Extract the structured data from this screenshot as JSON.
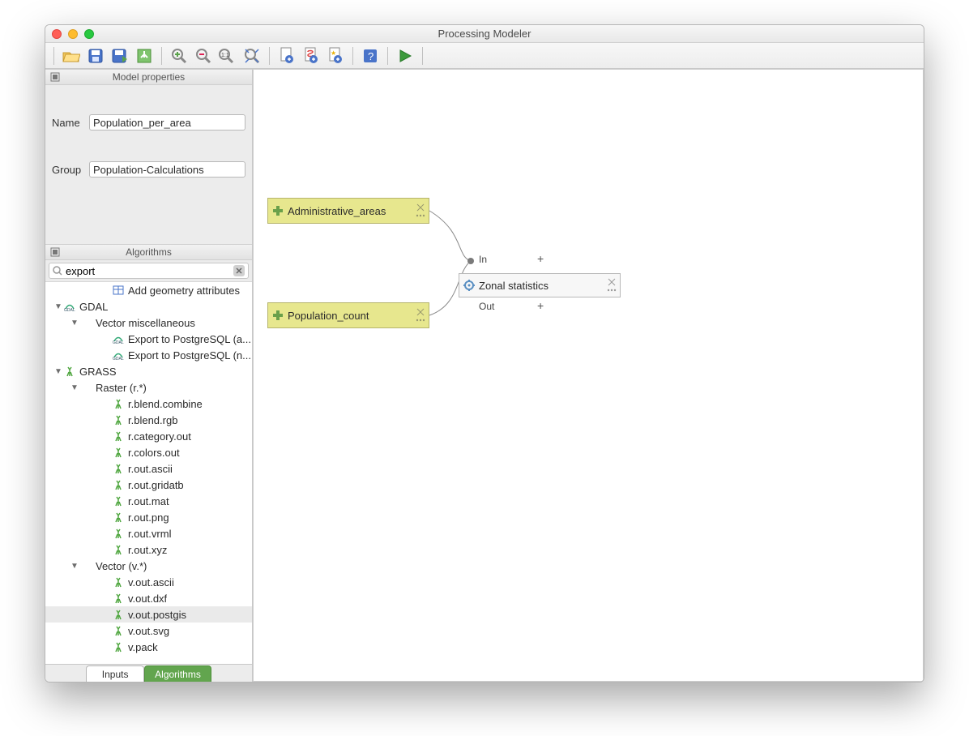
{
  "window": {
    "title": "Processing Modeler"
  },
  "toolbar": {
    "open": "open-folder-icon",
    "save": "save-icon",
    "saveas": "save-as-icon",
    "open_model": "open-model-icon",
    "zoom_in": "zoom-in-icon",
    "zoom_out": "zoom-out-icon",
    "zoom_11": "zoom-1-1-icon",
    "zoom_full": "zoom-full-icon",
    "export_img": "export-image-icon",
    "export_pdf": "export-pdf-icon",
    "export_py": "export-python-icon",
    "help": "help-icon",
    "run": "run-icon"
  },
  "panels": {
    "model_properties": "Model properties",
    "algorithms": "Algorithms"
  },
  "props": {
    "name_label": "Name",
    "name_value": "Population_per_area",
    "group_label": "Group",
    "group_value": "Population-Calculations"
  },
  "search": {
    "value": "export",
    "placeholder": ""
  },
  "tree": [
    {
      "d": 3,
      "disc": "",
      "ico": "table",
      "label": "Add geometry attributes"
    },
    {
      "d": 0,
      "disc": "▼",
      "ico": "gdal",
      "label": "GDAL"
    },
    {
      "d": 1,
      "disc": "▼",
      "ico": "",
      "label": "Vector miscellaneous"
    },
    {
      "d": 3,
      "disc": "",
      "ico": "gdal",
      "label": "Export to PostgreSQL (a..."
    },
    {
      "d": 3,
      "disc": "",
      "ico": "gdal",
      "label": "Export to PostgreSQL (n..."
    },
    {
      "d": 0,
      "disc": "▼",
      "ico": "grass",
      "label": "GRASS"
    },
    {
      "d": 1,
      "disc": "▼",
      "ico": "",
      "label": "Raster (r.*)"
    },
    {
      "d": 3,
      "disc": "",
      "ico": "grass",
      "label": "r.blend.combine"
    },
    {
      "d": 3,
      "disc": "",
      "ico": "grass",
      "label": "r.blend.rgb"
    },
    {
      "d": 3,
      "disc": "",
      "ico": "grass",
      "label": "r.category.out"
    },
    {
      "d": 3,
      "disc": "",
      "ico": "grass",
      "label": "r.colors.out"
    },
    {
      "d": 3,
      "disc": "",
      "ico": "grass",
      "label": "r.out.ascii"
    },
    {
      "d": 3,
      "disc": "",
      "ico": "grass",
      "label": "r.out.gridatb"
    },
    {
      "d": 3,
      "disc": "",
      "ico": "grass",
      "label": "r.out.mat"
    },
    {
      "d": 3,
      "disc": "",
      "ico": "grass",
      "label": "r.out.png"
    },
    {
      "d": 3,
      "disc": "",
      "ico": "grass",
      "label": "r.out.vrml"
    },
    {
      "d": 3,
      "disc": "",
      "ico": "grass",
      "label": "r.out.xyz"
    },
    {
      "d": 1,
      "disc": "▼",
      "ico": "",
      "label": "Vector (v.*)"
    },
    {
      "d": 3,
      "disc": "",
      "ico": "grass",
      "label": "v.out.ascii"
    },
    {
      "d": 3,
      "disc": "",
      "ico": "grass",
      "label": "v.out.dxf"
    },
    {
      "d": 3,
      "disc": "",
      "ico": "grass",
      "label": "v.out.postgis",
      "sel": true
    },
    {
      "d": 3,
      "disc": "",
      "ico": "grass",
      "label": "v.out.svg"
    },
    {
      "d": 3,
      "disc": "",
      "ico": "grass",
      "label": "v.pack"
    }
  ],
  "tabs": {
    "inputs": "Inputs",
    "algorithms": "Algorithms"
  },
  "canvas": {
    "input1": "Administrative_areas",
    "input2": "Population_count",
    "algo": "Zonal statistics",
    "in_label": "In",
    "out_label": "Out",
    "plus1": "+",
    "plus2": "+"
  }
}
